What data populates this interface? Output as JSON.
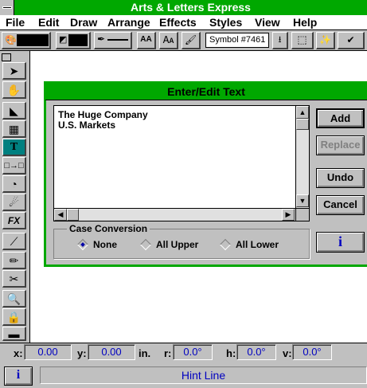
{
  "app": {
    "title": "Arts & Letters Express"
  },
  "menu": [
    {
      "label": "File"
    },
    {
      "label": "Edit"
    },
    {
      "label": "Draw"
    },
    {
      "label": "Arrange"
    },
    {
      "label": "Effects"
    },
    {
      "label": "Styles"
    },
    {
      "label": "View"
    },
    {
      "label": "Help"
    }
  ],
  "toolbar": {
    "symbol": "Symbol #7461",
    "text_size_label": "AA"
  },
  "dialog": {
    "title": "Enter/Edit Text",
    "text_line1": "The Huge Company",
    "text_line2": "U.S. Markets",
    "buttons": {
      "add": "Add",
      "replace": "Replace",
      "undo": "Undo",
      "cancel": "Cancel",
      "info": "i"
    },
    "case_conversion": {
      "label": "Case Conversion",
      "options": [
        {
          "label": "None",
          "selected": true
        },
        {
          "label": "All Upper"
        },
        {
          "label": "All Lower"
        }
      ]
    }
  },
  "status": {
    "x_label": "x:",
    "x_value": "0.00",
    "y_label": "y:",
    "y_value": "0.00",
    "unit": "in.",
    "r_label": "r:",
    "r_value": "0.0°",
    "h_label": "h:",
    "h_value": "0.0°",
    "v_label": "v:",
    "v_value": "0.0°",
    "hint": "Hint Line",
    "info": "i"
  },
  "colors": {
    "title_green": "#00a800",
    "face": "#c0c0c0",
    "status_blue": "#0000c0"
  }
}
